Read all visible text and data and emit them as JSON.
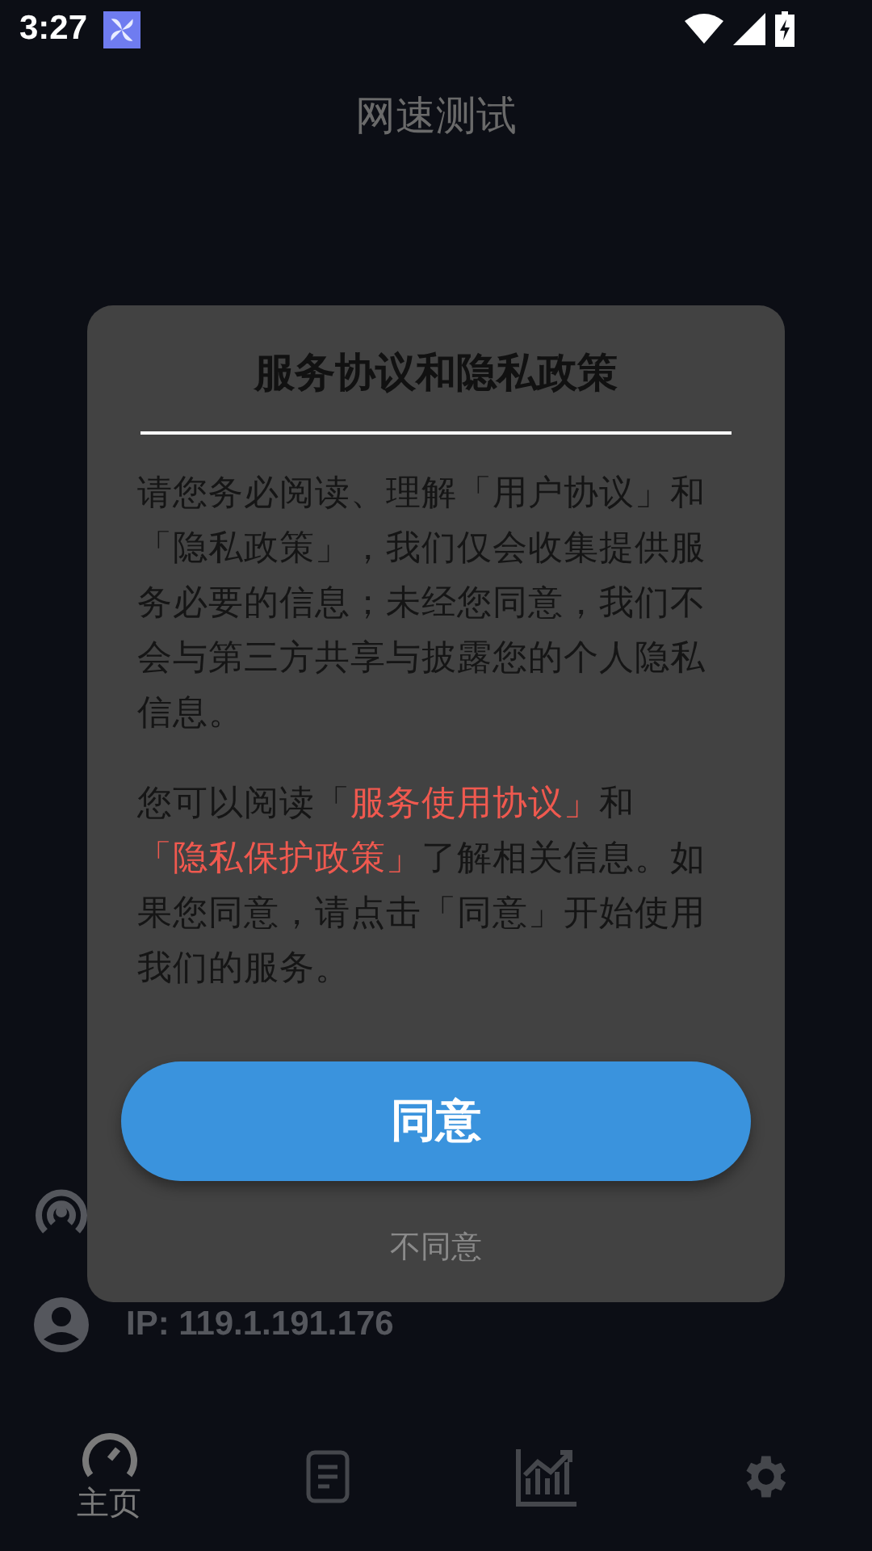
{
  "status_bar": {
    "time": "3:27"
  },
  "app_bar": {
    "title": "网速测试"
  },
  "info_rows": [
    {
      "kind": "network"
    },
    {
      "kind": "user",
      "text": "IP: 119.1.191.176"
    }
  ],
  "bottom_nav": [
    {
      "kind": "speed",
      "label": "主页",
      "selected": true
    },
    {
      "kind": "doc",
      "selected": false
    },
    {
      "kind": "chart",
      "selected": false
    },
    {
      "kind": "settings",
      "selected": false
    }
  ],
  "dialog": {
    "title": "服务协议和隐私政策",
    "paragraphs": [
      [
        {
          "kind": "text",
          "text": "请您务必阅读、理解「用户协议」和「隐私政策」，我们仅会收集提供服务必要的信息；未经您同意，我们不会与第三方共享与披露您的个人隐私信息。"
        }
      ],
      [
        {
          "kind": "text",
          "text": "您可以阅读「"
        },
        {
          "kind": "link",
          "text": "服务使用协议」"
        },
        {
          "kind": "text",
          "text": "和"
        },
        {
          "kind": "link",
          "text": "「隐私保护政策」"
        },
        {
          "kind": "text",
          "text": "了解相关信息。如果您同意，请点击「同意」开始使用我们的服务。"
        }
      ]
    ],
    "agree": "同意",
    "disagree": "不同意"
  }
}
